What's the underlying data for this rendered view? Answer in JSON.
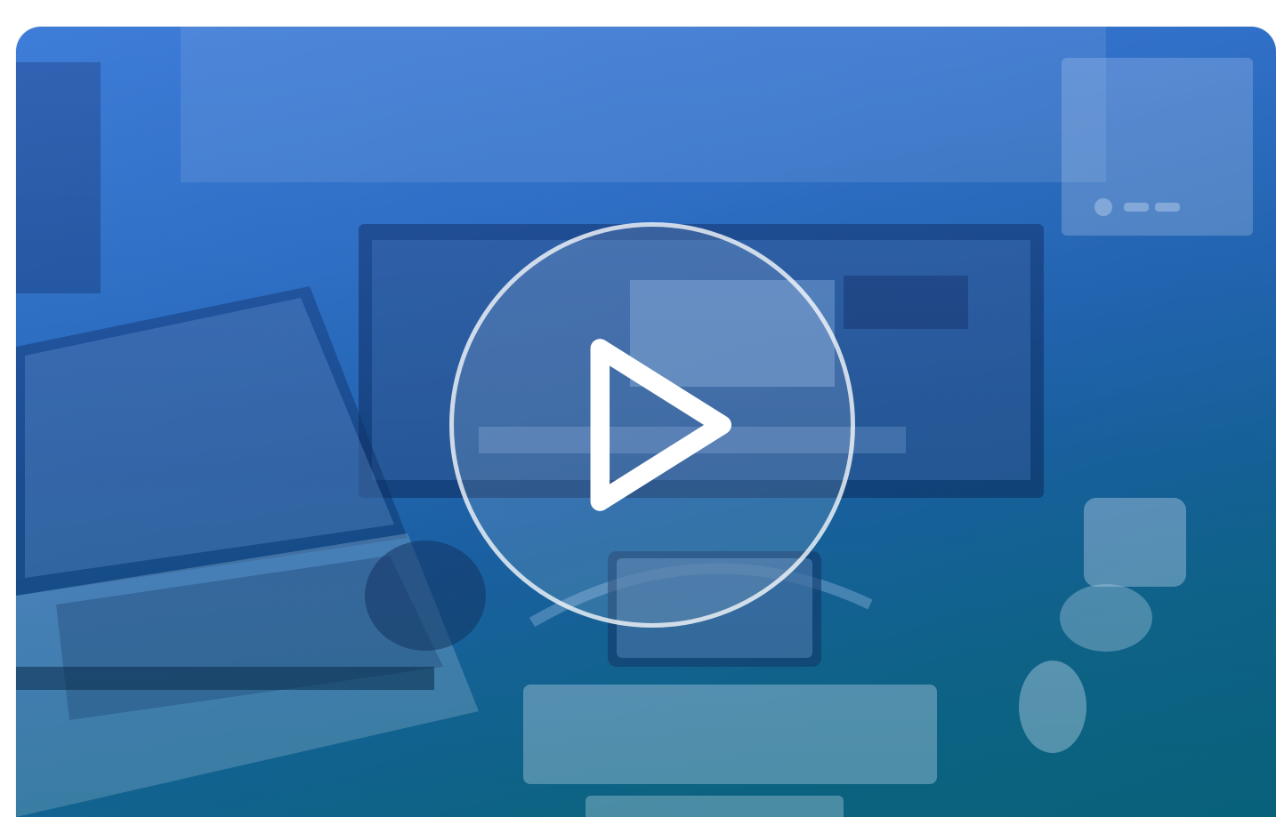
{
  "video": {
    "play_label": "",
    "colors": {
      "overlay_top": "#3f7fd6",
      "overlay_bottom": "#0a5f7b",
      "play_ring": "#ffffff"
    },
    "icon": "play-icon"
  }
}
